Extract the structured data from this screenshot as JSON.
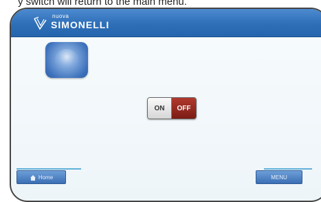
{
  "caption": "y switch will return to the main menu.",
  "header": {
    "brand_small": "nuova",
    "brand": "SIMONELLI"
  },
  "main": {
    "app_icon": "blue-rounded-circle-icon"
  },
  "toggle": {
    "on_label": "ON",
    "off_label": "OFF",
    "state": "off"
  },
  "footer": {
    "home_label": "Home",
    "menu_label": "MENU"
  }
}
